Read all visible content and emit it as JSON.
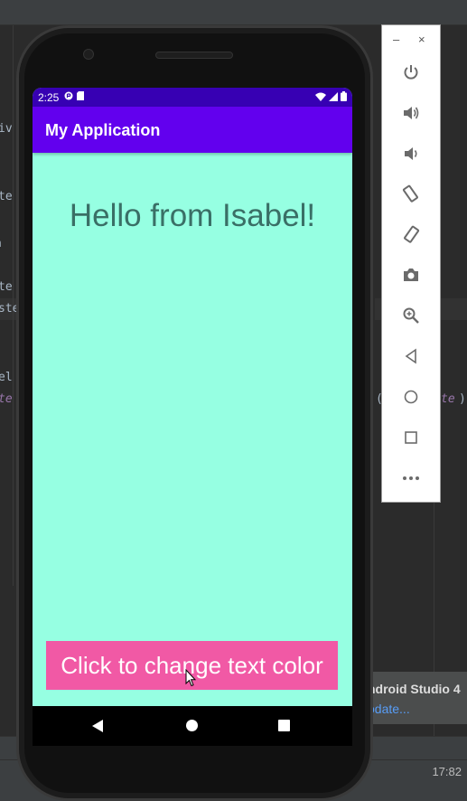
{
  "ide": {
    "code_fragments": [
      "iv",
      "te",
      "a",
      "te",
      "ste",
      "el",
      "te",
      "t",
      "(",
      "te",
      ")"
    ],
    "notification_title": "ndroid Studio 4",
    "notification_link": "odate...",
    "status_time": "17:82"
  },
  "emulator": {
    "window_controls": {
      "minimize": "–",
      "close": "×"
    },
    "toolbar_icons": [
      "power-icon",
      "volume-up-icon",
      "volume-down-icon",
      "rotate-left-icon",
      "rotate-right-icon",
      "camera-icon",
      "zoom-icon",
      "back-icon",
      "home-icon",
      "overview-icon",
      "more-icon"
    ]
  },
  "phone": {
    "status_bar": {
      "time": "2:25"
    },
    "app_bar": {
      "title": "My Application",
      "color": "#6200ee",
      "status_color": "#3700b3"
    },
    "screen_background": "#96ffe2",
    "greeting": "Hello from Isabel!",
    "greeting_color": "#3a6f66",
    "button": {
      "label": "Click to change text color",
      "color": "#f159a5"
    }
  }
}
